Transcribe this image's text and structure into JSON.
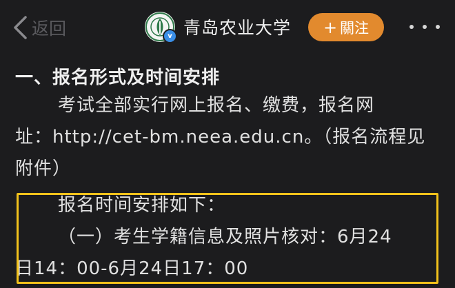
{
  "header": {
    "back_label": "返回",
    "account_name": "青岛农业大学",
    "follow_plus": "+",
    "follow_label": "關注",
    "verified_mark": "v"
  },
  "article": {
    "heading": "一、报名形式及时间安排",
    "paragraph1": [
      "考试全部实行网上报名、缴费，报名网",
      "址：http://cet-bm.neea.edu.cn。（报名流程见",
      "附件）"
    ],
    "paragraph2": [
      "报名时间安排如下：",
      "（一）考生学籍信息及照片核对：6月24",
      "日14：00-6月24日17：00"
    ]
  },
  "colors": {
    "background": "#1c1c1e",
    "accent_follow": "#e28a2e",
    "highlight_border": "#f3c21b",
    "verified_badge": "#3a8ee6"
  }
}
